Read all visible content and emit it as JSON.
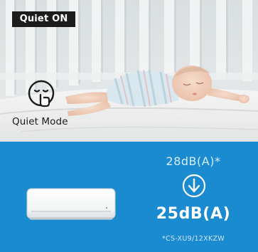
{
  "badge": {
    "label": "Quiet ON"
  },
  "mode": {
    "label": "Quiet Mode",
    "icon": "shush-face-icon"
  },
  "sound": {
    "before": "28dB(A)*",
    "after": "25dB(A)",
    "arrow_icon": "down-arrow-circle-icon",
    "footnote": "*CS-XU9/12XKZW"
  },
  "colors": {
    "panel": "#1a8bd0",
    "badge_bg": "#1c1c1c",
    "text_light": "#ffffff"
  }
}
